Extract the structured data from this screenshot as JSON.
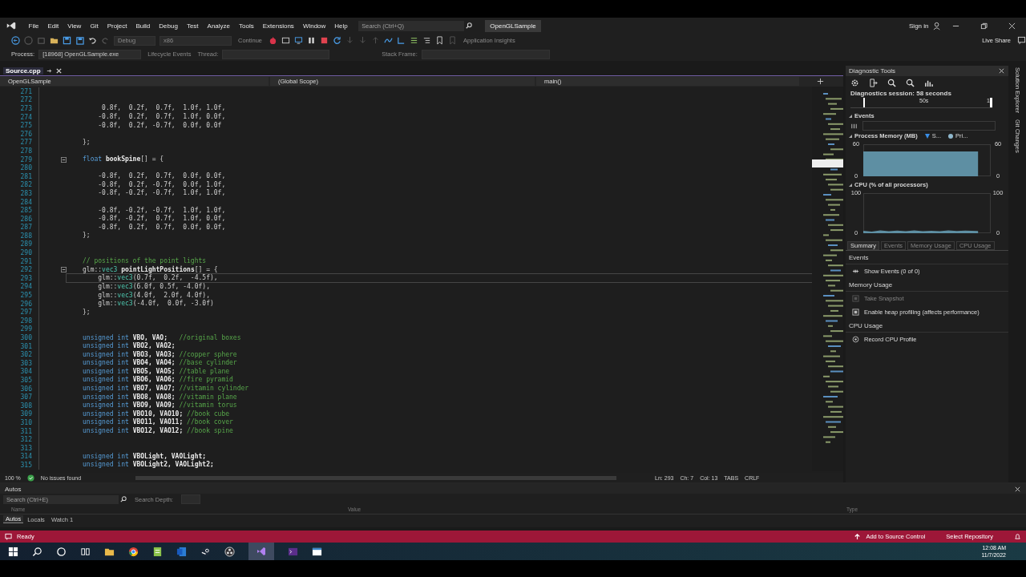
{
  "menu": [
    "File",
    "Edit",
    "View",
    "Git",
    "Project",
    "Build",
    "Debug",
    "Test",
    "Analyze",
    "Tools",
    "Extensions",
    "Window",
    "Help"
  ],
  "search": {
    "placeholder": "Search (Ctrl+Q)"
  },
  "solution_name": "OpenGLSample",
  "sign_in": "Sign in",
  "toolbar": {
    "configuration": {
      "label": "Debug",
      "disabled": true
    },
    "platform": {
      "label": "x86",
      "disabled": true
    },
    "continue": {
      "label": "Continue",
      "disabled": true
    },
    "insights": {
      "label": "Application Insights",
      "disabled": true
    },
    "live_share": "Live Share"
  },
  "process_bar": {
    "process_label": "Process:",
    "process": "[18968] OpenGLSample.exe",
    "lifecycle": {
      "label": "Lifecycle Events",
      "disabled": true
    },
    "thread_label": "Thread:",
    "stack_label": "Stack Frame:"
  },
  "doc_tabs": [
    {
      "label": "Source.cpp",
      "selected": true
    }
  ],
  "nav_bar": [
    "OpenGLSample",
    "(Global Scope)",
    "main()"
  ],
  "code_lines": [
    {
      "number": "271",
      "kind": "normal"
    },
    {
      "number": "272",
      "kind": "normal"
    },
    {
      "number": "273",
      "kind": "normal",
      "tokens": [
        {
          "kind": "text",
          "text": "     0.8f,  0.2f,  0.7f,  1.0f, 1.0f,"
        }
      ]
    },
    {
      "number": "274",
      "kind": "normal",
      "tokens": [
        {
          "kind": "text",
          "text": "    -0.8f,  0.2f,  0.7f,  1.0f, 0.0f,"
        }
      ]
    },
    {
      "number": "275",
      "kind": "normal",
      "tokens": [
        {
          "kind": "text",
          "text": "    -0.8f,  0.2f, -0.7f,  0.0f, 0.0f"
        }
      ]
    },
    {
      "number": "276",
      "kind": "normal"
    },
    {
      "number": "277",
      "kind": "normal",
      "tokens": [
        {
          "kind": "text",
          "text": "};"
        }
      ]
    },
    {
      "number": "278",
      "kind": "normal"
    },
    {
      "number": "279",
      "kind": "fold",
      "tokens": [
        {
          "kind": "kw",
          "text": "float "
        },
        {
          "kind": "name",
          "text": "bookSpine"
        },
        {
          "kind": "text",
          "text": "[] = {"
        }
      ]
    },
    {
      "number": "280",
      "kind": "normal"
    },
    {
      "number": "281",
      "kind": "normal",
      "tokens": [
        {
          "kind": "text",
          "text": "    -0.8f,  0.2f,  0.7f,  0.0f, 0.0f,"
        }
      ]
    },
    {
      "number": "282",
      "kind": "normal",
      "tokens": [
        {
          "kind": "text",
          "text": "    -0.8f,  0.2f, -0.7f,  0.0f, 1.0f,"
        }
      ]
    },
    {
      "number": "283",
      "kind": "normal",
      "tokens": [
        {
          "kind": "text",
          "text": "    -0.8f, -0.2f, -0.7f,  1.0f, 1.0f,"
        }
      ]
    },
    {
      "number": "284",
      "kind": "normal"
    },
    {
      "number": "285",
      "kind": "normal",
      "tokens": [
        {
          "kind": "text",
          "text": "    -0.8f, -0.2f, -0.7f,  1.0f, 1.0f,"
        }
      ]
    },
    {
      "number": "286",
      "kind": "normal",
      "tokens": [
        {
          "kind": "text",
          "text": "    -0.8f, -0.2f,  0.7f,  1.0f, 0.0f,"
        }
      ]
    },
    {
      "number": "287",
      "kind": "normal",
      "tokens": [
        {
          "kind": "text",
          "text": "    -0.8f,  0.2f,  0.7f,  0.0f, 0.0f,"
        }
      ]
    },
    {
      "number": "288",
      "kind": "normal",
      "tokens": [
        {
          "kind": "text",
          "text": "};"
        }
      ]
    },
    {
      "number": "289",
      "kind": "normal"
    },
    {
      "number": "290",
      "kind": "normal"
    },
    {
      "number": "291",
      "kind": "normal",
      "tokens": [
        {
          "kind": "comment",
          "text": "// positions of the point lights"
        }
      ]
    },
    {
      "number": "292",
      "kind": "fold",
      "tokens": [
        {
          "kind": "text",
          "text": "glm::"
        },
        {
          "kind": "type",
          "text": "vec3 "
        },
        {
          "kind": "name",
          "text": "pointLightPositions"
        },
        {
          "kind": "text",
          "text": "[] = {"
        }
      ]
    },
    {
      "number": "293",
      "kind": "current",
      "tokens": [
        {
          "kind": "text",
          "text": "    glm::"
        },
        {
          "kind": "type",
          "text": "vec3"
        },
        {
          "kind": "text",
          "text": "(0.7f,  0.2f,  -4.5f),"
        }
      ]
    },
    {
      "number": "294",
      "kind": "normal",
      "tokens": [
        {
          "kind": "text",
          "text": "    glm::"
        },
        {
          "kind": "type",
          "text": "vec3"
        },
        {
          "kind": "text",
          "text": "(6.0f, 0.5f, -4.0f),"
        }
      ]
    },
    {
      "number": "295",
      "kind": "normal",
      "tokens": [
        {
          "kind": "text",
          "text": "    glm::"
        },
        {
          "kind": "type",
          "text": "vec3"
        },
        {
          "kind": "text",
          "text": "(4.0f,  2.0f, 4.0f),"
        }
      ]
    },
    {
      "number": "296",
      "kind": "normal",
      "tokens": [
        {
          "kind": "text",
          "text": "    glm::"
        },
        {
          "kind": "type",
          "text": "vec3"
        },
        {
          "kind": "text",
          "text": "(-4.0f,  0.0f, -3.0f)"
        }
      ]
    },
    {
      "number": "297",
      "kind": "normal",
      "tokens": [
        {
          "kind": "text",
          "text": "};"
        }
      ]
    },
    {
      "number": "298",
      "kind": "normal"
    },
    {
      "number": "299",
      "kind": "normal"
    },
    {
      "number": "300",
      "kind": "normal",
      "tokens": [
        {
          "kind": "kw",
          "text": "unsigned int "
        },
        {
          "kind": "name",
          "text": "VBO, VAO;   "
        },
        {
          "kind": "comment",
          "text": "//original boxes"
        }
      ]
    },
    {
      "number": "301",
      "kind": "normal",
      "tokens": [
        {
          "kind": "kw",
          "text": "unsigned int "
        },
        {
          "kind": "name",
          "text": "VBO2, VAO2;"
        }
      ]
    },
    {
      "number": "302",
      "kind": "normal",
      "tokens": [
        {
          "kind": "kw",
          "text": "unsigned int "
        },
        {
          "kind": "name",
          "text": "VBO3, VAO3; "
        },
        {
          "kind": "comment",
          "text": "//copper sphere"
        }
      ]
    },
    {
      "number": "303",
      "kind": "normal",
      "tokens": [
        {
          "kind": "kw",
          "text": "unsigned int "
        },
        {
          "kind": "name",
          "text": "VBO4, VAO4; "
        },
        {
          "kind": "comment",
          "text": "//base cylinder"
        }
      ]
    },
    {
      "number": "304",
      "kind": "normal",
      "tokens": [
        {
          "kind": "kw",
          "text": "unsigned int "
        },
        {
          "kind": "name",
          "text": "VBO5, VAO5; "
        },
        {
          "kind": "comment",
          "text": "//table plane"
        }
      ]
    },
    {
      "number": "305",
      "kind": "normal",
      "tokens": [
        {
          "kind": "kw",
          "text": "unsigned int "
        },
        {
          "kind": "name",
          "text": "VBO6, VAO6; "
        },
        {
          "kind": "comment",
          "text": "//fire pyramid"
        }
      ]
    },
    {
      "number": "306",
      "kind": "normal",
      "tokens": [
        {
          "kind": "kw",
          "text": "unsigned int "
        },
        {
          "kind": "name",
          "text": "VBO7, VAO7; "
        },
        {
          "kind": "comment",
          "text": "//vitamin cylinder"
        }
      ]
    },
    {
      "number": "307",
      "kind": "normal",
      "tokens": [
        {
          "kind": "kw",
          "text": "unsigned int "
        },
        {
          "kind": "name",
          "text": "VBO8, VAO8; "
        },
        {
          "kind": "comment",
          "text": "//vitamin plane"
        }
      ]
    },
    {
      "number": "308",
      "kind": "normal",
      "tokens": [
        {
          "kind": "kw",
          "text": "unsigned int "
        },
        {
          "kind": "name",
          "text": "VBO9, VAO9; "
        },
        {
          "kind": "comment",
          "text": "//vitamin torus"
        }
      ]
    },
    {
      "number": "309",
      "kind": "normal",
      "tokens": [
        {
          "kind": "kw",
          "text": "unsigned int "
        },
        {
          "kind": "name",
          "text": "VBO10, VAO10; "
        },
        {
          "kind": "comment",
          "text": "//book cube"
        }
      ]
    },
    {
      "number": "310",
      "kind": "normal",
      "tokens": [
        {
          "kind": "kw",
          "text": "unsigned int "
        },
        {
          "kind": "name",
          "text": "VBO11, VAO11; "
        },
        {
          "kind": "comment",
          "text": "//book cover"
        }
      ]
    },
    {
      "number": "311",
      "kind": "normal",
      "tokens": [
        {
          "kind": "kw",
          "text": "unsigned int "
        },
        {
          "kind": "name",
          "text": "VBO12, VAO12; "
        },
        {
          "kind": "comment",
          "text": "//book spine"
        }
      ]
    },
    {
      "number": "312",
      "kind": "normal"
    },
    {
      "number": "313",
      "kind": "normal"
    },
    {
      "number": "314",
      "kind": "normal",
      "tokens": [
        {
          "kind": "kw",
          "text": "unsigned int "
        },
        {
          "kind": "name",
          "text": "VBOLight, VAOLight;"
        }
      ]
    },
    {
      "number": "315",
      "kind": "normal",
      "tokens": [
        {
          "kind": "kw",
          "text": "unsigned int "
        },
        {
          "kind": "name",
          "text": "VBOLight2, VAOLight2;"
        }
      ]
    }
  ],
  "editor_status": {
    "zoom": "100 %",
    "issues": "No issues found",
    "line": "Ln: 293",
    "char": "Ch: 7",
    "col": "Col: 13",
    "indent": "TABS",
    "line_ending": "CRLF"
  },
  "diagnostics": {
    "title": "Diagnostic Tools",
    "session": "Diagnostics session: 58 seconds",
    "timeline_ticks": [
      "50s",
      "1"
    ],
    "events_title": "Events",
    "memory": {
      "title": "Process Memory (MB)",
      "legend": [
        {
          "label": "S...",
          "color": "#3a8ee6"
        },
        {
          "label": "Pri...",
          "color": "#8fb7cc"
        }
      ],
      "left_axis_labels": [
        "60",
        "0"
      ],
      "right_axis_labels": [
        "60",
        "0"
      ]
    },
    "cpu": {
      "title": "CPU (% of all processors)",
      "left_axis_labels": [
        "100",
        "0"
      ],
      "right_axis_labels": [
        "100",
        "0"
      ]
    },
    "tabs": [
      {
        "label": "Summary",
        "selected": true
      },
      {
        "label": "Events",
        "selected": false
      },
      {
        "label": "Memory Usage",
        "selected": false
      },
      {
        "label": "CPU Usage",
        "selected": false
      }
    ],
    "sections": [
      {
        "title": "Events",
        "items": [
          {
            "label": "Show Events (0 of 0)",
            "disabled": false
          }
        ]
      },
      {
        "title": "Memory Usage",
        "items": [
          {
            "label": "Take Snapshot",
            "disabled": true
          },
          {
            "label": "Enable heap profiling (affects performance)",
            "disabled": false
          }
        ]
      },
      {
        "title": "CPU Usage",
        "items": [
          {
            "label": "Record CPU Profile",
            "disabled": false
          }
        ]
      }
    ]
  },
  "side_tabs": [
    "Solution Explorer",
    "Git Changes"
  ],
  "autos": {
    "title": "Autos",
    "search": {
      "placeholder": "Search (Ctrl+E)"
    },
    "depth_label": "Search Depth:",
    "columns": [
      "Name",
      "Value",
      "Type"
    ],
    "tabs": [
      {
        "label": "Autos",
        "selected": true
      },
      {
        "label": "Locals",
        "selected": false
      },
      {
        "label": "Watch 1",
        "selected": false
      }
    ]
  },
  "status_bar": {
    "state": "Ready",
    "source_control": "Add to Source Control",
    "repository": "Select Repository"
  },
  "taskbar": {
    "time": "12:08 AM",
    "date": "11/7/2022"
  }
}
